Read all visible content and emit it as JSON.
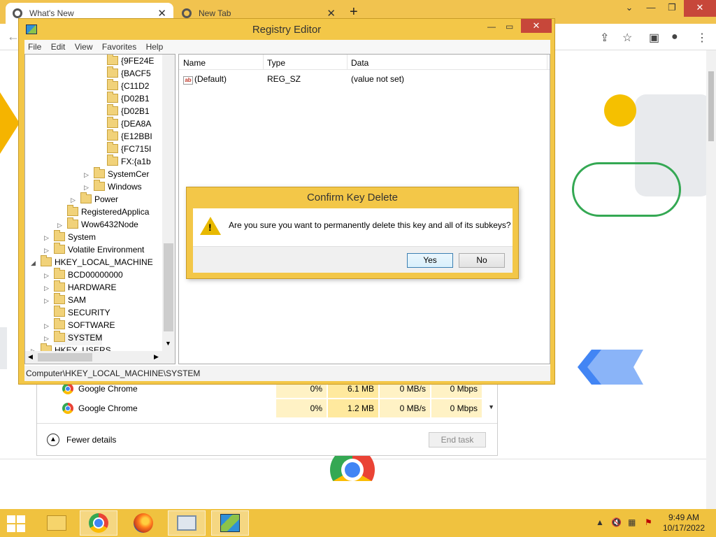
{
  "browser": {
    "tabs": [
      {
        "label": "What's New",
        "close": "✕"
      },
      {
        "label": "New Tab",
        "close": "✕"
      }
    ],
    "new_tab": "+",
    "controls": {
      "minimize": "⌄",
      "restore": "—",
      "maximize": "❐",
      "close": "✕"
    }
  },
  "task_manager": {
    "rows": [
      {
        "name": "Google Chrome",
        "cpu": "0%",
        "memory": "6.1 MB",
        "disk": "0 MB/s",
        "network": "0 Mbps"
      },
      {
        "name": "Google Chrome",
        "cpu": "0%",
        "memory": "1.2 MB",
        "disk": "0 MB/s",
        "network": "0 Mbps"
      }
    ],
    "fewer_details": "Fewer details",
    "end_task": "End task"
  },
  "regedit": {
    "title": "Registry Editor",
    "menu": [
      "File",
      "Edit",
      "View",
      "Favorites",
      "Help"
    ],
    "tree": [
      {
        "label": "{9FE24E",
        "depth": 6,
        "expander": ""
      },
      {
        "label": "{BACF5",
        "depth": 6,
        "expander": ""
      },
      {
        "label": "{C11D2",
        "depth": 6,
        "expander": ""
      },
      {
        "label": "{D02B1",
        "depth": 6,
        "expander": ""
      },
      {
        "label": "{D02B1",
        "depth": 6,
        "expander": ""
      },
      {
        "label": "{DEA8A",
        "depth": 6,
        "expander": ""
      },
      {
        "label": "{E12BBI",
        "depth": 6,
        "expander": ""
      },
      {
        "label": "{FC715I",
        "depth": 6,
        "expander": ""
      },
      {
        "label": "FX:{a1b",
        "depth": 6,
        "expander": ""
      },
      {
        "label": "SystemCer",
        "depth": 5,
        "expander": "▷"
      },
      {
        "label": "Windows",
        "depth": 5,
        "expander": "▷"
      },
      {
        "label": "Power",
        "depth": 4,
        "expander": "▷"
      },
      {
        "label": "RegisteredApplica",
        "depth": 3,
        "expander": ""
      },
      {
        "label": "Wow6432Node",
        "depth": 3,
        "expander": "▷"
      },
      {
        "label": "System",
        "depth": 2,
        "expander": "▷"
      },
      {
        "label": "Volatile Environment",
        "depth": 2,
        "expander": "▷"
      },
      {
        "label": "HKEY_LOCAL_MACHINE",
        "depth": 1,
        "expander": "◢"
      },
      {
        "label": "BCD00000000",
        "depth": 2,
        "expander": "▷"
      },
      {
        "label": "HARDWARE",
        "depth": 2,
        "expander": "▷"
      },
      {
        "label": "SAM",
        "depth": 2,
        "expander": "▷"
      },
      {
        "label": "SECURITY",
        "depth": 2,
        "expander": ""
      },
      {
        "label": "SOFTWARE",
        "depth": 2,
        "expander": "▷"
      },
      {
        "label": "SYSTEM",
        "depth": 2,
        "expander": "▷"
      },
      {
        "label": "HKEY_USERS",
        "depth": 1,
        "expander": "▷"
      }
    ],
    "columns": {
      "name": "Name",
      "type": "Type",
      "data": "Data"
    },
    "values": [
      {
        "icon": "ab",
        "name": "(Default)",
        "type": "REG_SZ",
        "data": "(value not set)"
      }
    ],
    "status_path": "Computer\\HKEY_LOCAL_MACHINE\\SYSTEM"
  },
  "dialog": {
    "title": "Confirm Key Delete",
    "message": "Are you sure you want to permanently delete this key and all of its subkeys?",
    "yes": "Yes",
    "no": "No"
  },
  "taskbar": {
    "apps": [
      "file-explorer",
      "google-chrome",
      "firefox",
      "task-manager",
      "registry-editor"
    ],
    "time": "9:49 AM",
    "date": "10/17/2022"
  },
  "colors": {
    "accent": "#f3c748",
    "selection": "#3c7fb1",
    "chrome_close": "#c7473a"
  }
}
